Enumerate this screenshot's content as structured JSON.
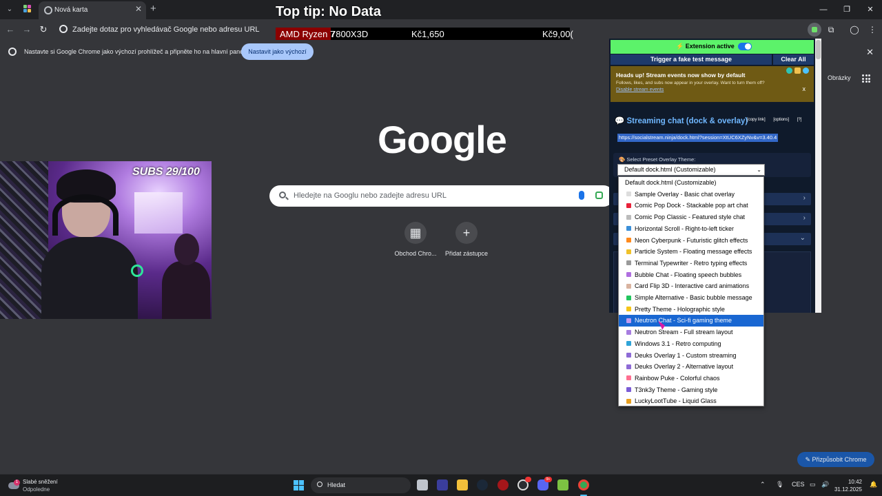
{
  "browser": {
    "tab_title": "Nová karta",
    "new_tab_symbol": "+",
    "omnibox_placeholder": "Zadejte dotaz pro vyhledávač Google nebo adresu URL",
    "infobar_text": "Nastavte si Google Chrome jako výchozí prohlížeč a připněte ho na hlavní panel",
    "infobar_button": "Nastavit jako výchozí"
  },
  "overlay": {
    "top_tip": "Top tip: No Data",
    "ticker_item": "AMD Ryzen 7",
    "ticker_item_rest": "7800X3D",
    "ticker_price_1": "Kč1,650",
    "ticker_price_2": "Kč9,00(",
    "subs": "SUBS 29/100"
  },
  "ntp": {
    "logo": "Google",
    "images_link": "Obrázky",
    "search_placeholder": "Hledejte na Googlu nebo zadejte adresu URL",
    "shortcuts": [
      {
        "label": "Obchod Chro...",
        "glyph": "▦"
      },
      {
        "label": "Přidat zástupce",
        "glyph": "+"
      }
    ],
    "customize_button": "✎ Přizpůsobit Chrome"
  },
  "extension": {
    "active_label": "⚡ Extension active",
    "trigger_button": "Trigger a fake test message",
    "clear_button": "Clear All",
    "notice_title": "Heads up! Stream events now show by default",
    "notice_body": "Follows, likes, and subs now appear in your overlay. Want to turn them off?",
    "notice_link": "Disable stream events",
    "notice_close": "x",
    "section_title": "💬 Streaming chat (dock & overlay)",
    "link_copy": "[copy link]",
    "link_options": "[options]",
    "link_help": "[?]",
    "session_url": "https://socialstream.ninja/dock.html?session=XtUC6XZyNv&v=3.40.4",
    "preset_label": "🎨 Select Preset Overlay Theme:",
    "preset_value": "Default dock.html (Customizable)"
  },
  "dropdown": {
    "selected_index": 12,
    "options": [
      {
        "label": "Default dock.html (Customizable)",
        "color": ""
      },
      {
        "label": "Sample Overlay - Basic chat overlay",
        "color": "#dddddd"
      },
      {
        "label": "Comic Pop Dock - Stackable pop art chat",
        "color": "#e8223a"
      },
      {
        "label": "Comic Pop Classic - Featured style chat",
        "color": "#bbbbbb"
      },
      {
        "label": "Horizontal Scroll - Right-to-left ticker",
        "color": "#3b8fd9"
      },
      {
        "label": "Neon Cyberpunk - Futuristic glitch effects",
        "color": "#ff8a1d"
      },
      {
        "label": "Particle System - Floating message effects",
        "color": "#f0c22b"
      },
      {
        "label": "Terminal Typewriter - Retro typing effects",
        "color": "#9a9a9a"
      },
      {
        "label": "Bubble Chat - Floating speech bubbles",
        "color": "#b06fe0"
      },
      {
        "label": "Card Flip 3D - Interactive card animations",
        "color": "#d9b3a0"
      },
      {
        "label": "Simple Alternative - Basic bubble message",
        "color": "#22c55e"
      },
      {
        "label": "Pretty Theme - Holographic style",
        "color": "#f5c518"
      },
      {
        "label": "Neutron Chat - Sci-fi gaming theme",
        "color": "#c39bf0"
      },
      {
        "label": "Neutron Stream - Full stream layout",
        "color": "#a77de0"
      },
      {
        "label": "Windows 3.1 - Retro computing",
        "color": "#2fa4d8"
      },
      {
        "label": "Deuks Overlay 1 - Custom streaming",
        "color": "#8e6bd6"
      },
      {
        "label": "Deuks Overlay 2 - Alternative layout",
        "color": "#8e6bd6"
      },
      {
        "label": "Rainbow Puke - Colorful chaos",
        "color": "#ff6f91"
      },
      {
        "label": "T3nk3y Theme - Gaming style",
        "color": "#7b5cd6"
      },
      {
        "label": "LuckyLootTube - Liquid Glass",
        "color": "#e8a020"
      }
    ]
  },
  "taskbar": {
    "weather_badge": "1",
    "weather_line1": "Slabé sněžení",
    "weather_line2": "Odpoledne",
    "search_label": "Hledat",
    "discord_badge": "9+",
    "language": "CES",
    "time": "10:42",
    "date": "31.12.2025"
  }
}
